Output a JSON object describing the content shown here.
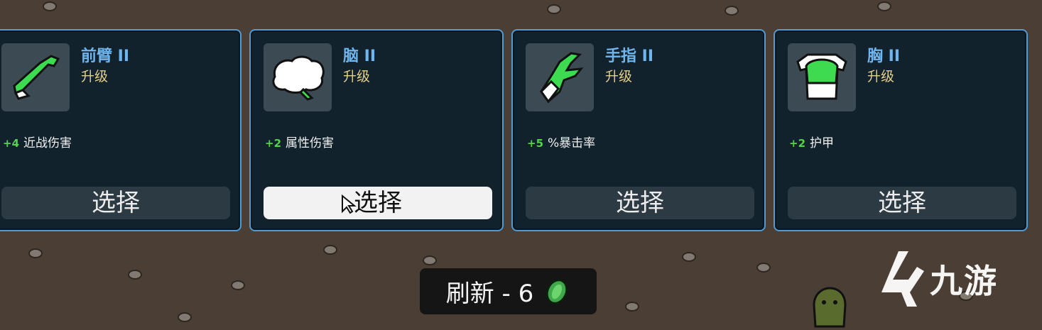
{
  "cards": [
    {
      "name": "前臂 II",
      "type": "升级",
      "stat_value": "+4",
      "stat_label": "近战伤害",
      "button": "选择",
      "icon": "forearm-icon"
    },
    {
      "name": "脑 II",
      "type": "升级",
      "stat_value": "+2",
      "stat_label": "属性伤害",
      "button": "选择",
      "icon": "brain-icon"
    },
    {
      "name": "手指 II",
      "type": "升级",
      "stat_value": "+5",
      "stat_label": "%暴击率",
      "button": "选择",
      "icon": "fingers-icon"
    },
    {
      "name": "胸 II",
      "type": "升级",
      "stat_value": "+2",
      "stat_label": "护甲",
      "button": "选择",
      "icon": "chest-icon"
    }
  ],
  "refresh": {
    "label": "刷新 - 6",
    "icon": "material-coin-icon"
  },
  "watermark": {
    "text": "九游",
    "icon": "jiuyou-logo-icon"
  },
  "colors": {
    "accent": "#4f9bd6",
    "name": "#6fb6ee",
    "type": "#e2cf8a",
    "plus": "#52d44a",
    "card_bg": "#12222d"
  }
}
